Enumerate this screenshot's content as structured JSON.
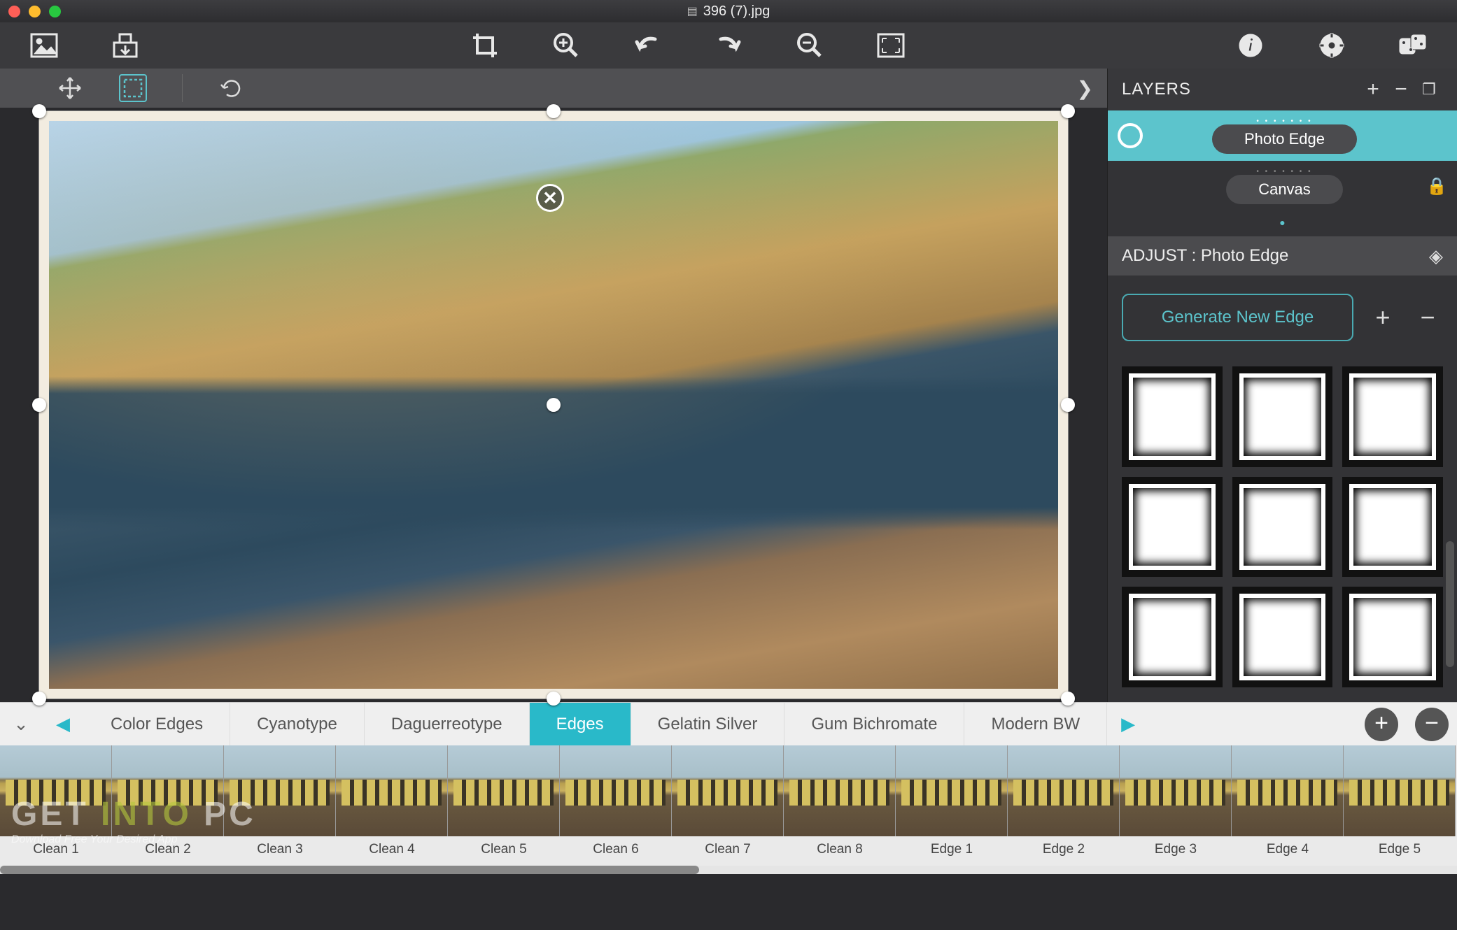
{
  "window": {
    "title": "396 (7).jpg"
  },
  "toolbar": {
    "open": "open",
    "save": "save",
    "crop": "crop",
    "zoom_in": "zoom-in",
    "undo": "undo",
    "redo": "redo",
    "zoom_out": "zoom-out",
    "fit": "fit-screen",
    "info": "info",
    "settings": "settings",
    "dice": "randomize"
  },
  "subtoolbar": {
    "move": "move-tool",
    "select": "marquee-tool",
    "rotate": "rotate-tool",
    "expand": "expand"
  },
  "sidebar": {
    "layers_title": "LAYERS",
    "layers": [
      {
        "name": "Photo Edge",
        "selected": true,
        "locked": false
      },
      {
        "name": "Canvas",
        "selected": false,
        "locked": true
      }
    ],
    "adjust_title": "ADJUST : Photo Edge",
    "generate_label": "Generate New Edge"
  },
  "categories": {
    "items": [
      "Color Edges",
      "Cyanotype",
      "Daguerreotype",
      "Edges",
      "Gelatin Silver",
      "Gum Bichromate",
      "Modern BW"
    ],
    "active": "Edges"
  },
  "thumbnails": [
    "Clean 1",
    "Clean 2",
    "Clean 3",
    "Clean 4",
    "Clean 5",
    "Clean 6",
    "Clean 7",
    "Clean 8",
    "Edge 1",
    "Edge 2",
    "Edge 3",
    "Edge 4",
    "Edge 5"
  ],
  "watermark": {
    "line1_a": "GET ",
    "line1_b": "INTO ",
    "line1_c": "PC",
    "line2": "Download Free Your Desired App"
  },
  "colors": {
    "accent": "#29b9c9",
    "panel": "#333336",
    "highlight": "#5cc4cc"
  }
}
